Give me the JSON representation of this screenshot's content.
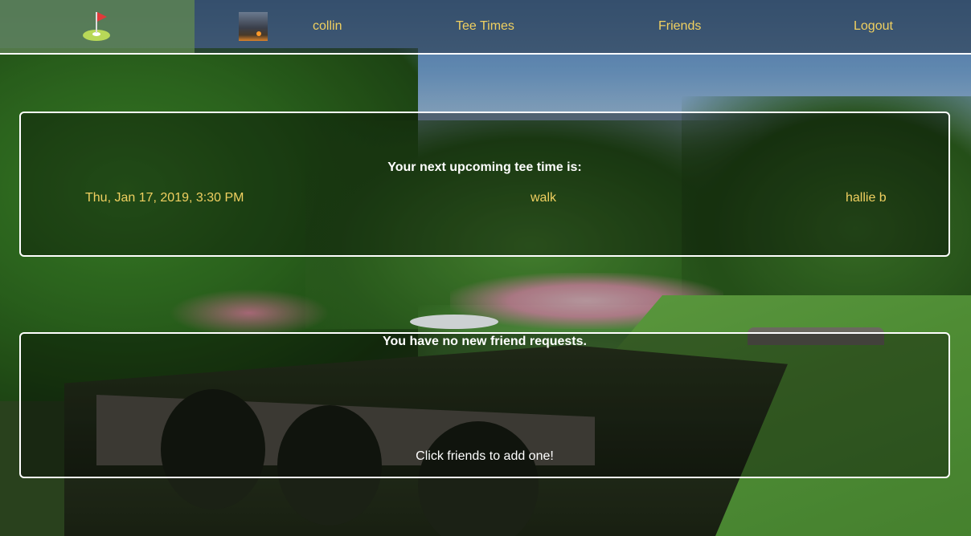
{
  "navbar": {
    "logo_icon": "golf-flag-icon",
    "username": "collin",
    "tee_times_label": "Tee Times",
    "friends_label": "Friends",
    "logout_label": "Logout"
  },
  "upcoming": {
    "heading": "Your next upcoming tee time is:",
    "date": "Thu, Jan 17, 2019, 3:30 PM",
    "mode": "walk",
    "partner": "hallie b"
  },
  "friend_requests": {
    "heading": "You have no new friend requests.",
    "hint": "Click friends to add one!"
  },
  "colors": {
    "link": "#f0d060",
    "panel_border": "#ffffff",
    "heading_text": "#ffffff"
  }
}
